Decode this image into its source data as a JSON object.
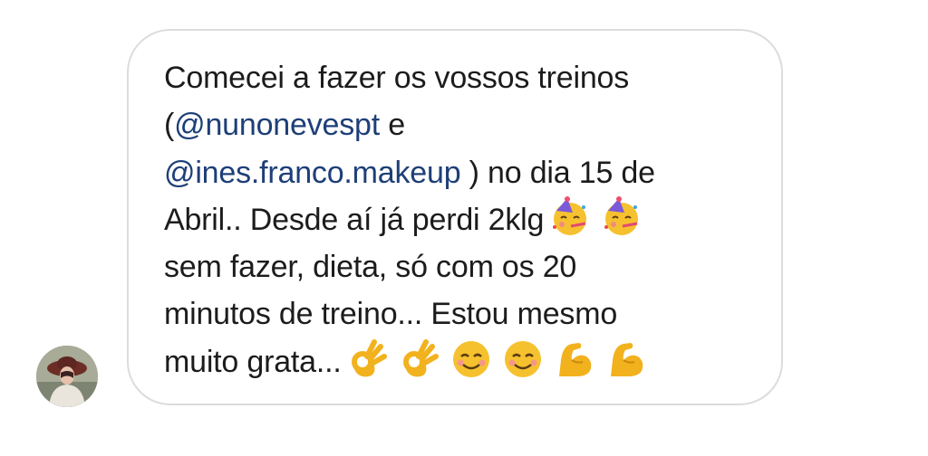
{
  "sender": {
    "avatar_icon": "user-avatar-photo"
  },
  "message": {
    "mention1": "@nunonevespt",
    "mention2": "@ines.franco.makeup",
    "lines": [
      "Comecei a fazer os vossos treinos",
      "(",
      " e",
      " ) no dia 15 de",
      "Abril.. Desde aí já perdi 2klg",
      "sem fazer, dieta, só com os 20",
      "minutos  de treino... Estou mesmo",
      "muito grata..."
    ],
    "line4_emojis": [
      "partying-face-emoji",
      "partying-face-emoji"
    ],
    "line8_emojis": [
      "ok-hand-emoji",
      "ok-hand-emoji",
      "smiling-face-emoji",
      "smiling-face-emoji",
      "flexed-biceps-emoji",
      "flexed-biceps-emoji"
    ]
  },
  "colors": {
    "text": "#1c1c1c",
    "mention": "#1e3f78",
    "bubble_border": "#dcdcdc",
    "emoji_yellow": "#f6c12f"
  }
}
